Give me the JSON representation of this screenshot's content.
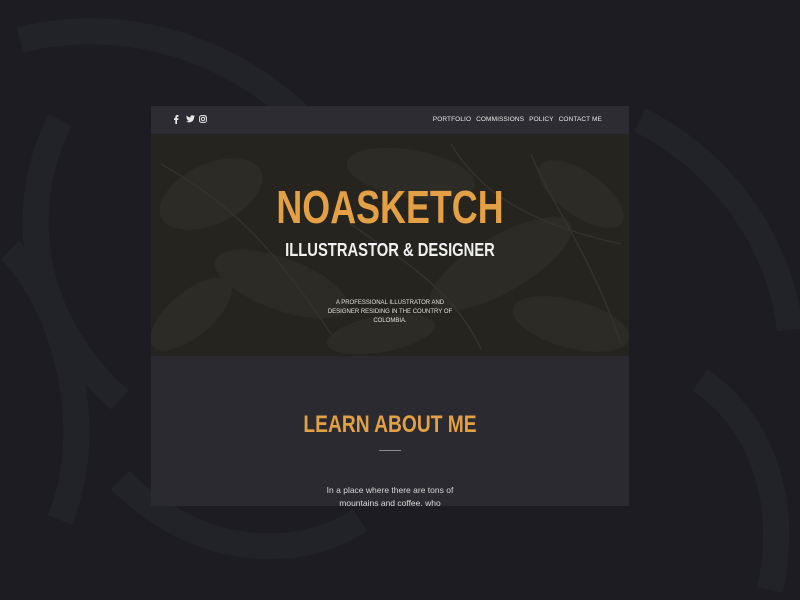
{
  "colors": {
    "page_bg": "#1c1c22",
    "card_bg": "#2a2a30",
    "accent": "#e3a044",
    "text_light": "#f0f0f0"
  },
  "nav": {
    "social_icons": [
      "facebook-icon",
      "twitter-icon",
      "instagram-icon"
    ],
    "menu": [
      {
        "label": "PORTFOLIO"
      },
      {
        "label": "COMMISSIONS"
      },
      {
        "label": "POLICY"
      },
      {
        "label": "CONTACT ME"
      }
    ]
  },
  "hero": {
    "title": "NOASKETCH",
    "subtitle": "ILLUSTRASTOR & DESIGNER",
    "description": "A PROFESSIONAL ILLUSTRATOR AND DESIGNER RESIDING IN THE COUNTRY OF COLOMBIA."
  },
  "about": {
    "title": "LEARN ABOUT ME",
    "text": "In a place where there are tons of mountains and coffee, who"
  }
}
